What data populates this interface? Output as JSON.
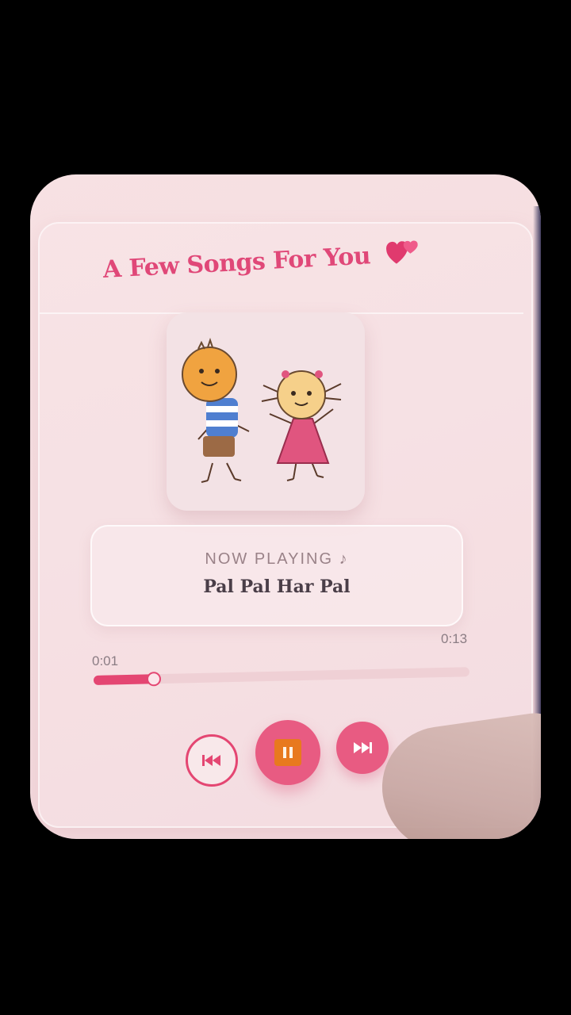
{
  "header": {
    "title": "A Few Songs For You",
    "title_emoji_icon": "two-hearts-icon"
  },
  "artwork": {
    "icon": "kids-dancing-illustration"
  },
  "now_playing": {
    "label": "NOW PLAYING ♪",
    "song_title": "Pal Pal Har Pal"
  },
  "progress": {
    "current_time": "0:01",
    "total_time": "0:13",
    "fraction": 0.16
  },
  "controls": {
    "prev_icon": "skip-previous-icon",
    "play_pause_icon": "pause-icon",
    "next_icon": "skip-next-icon"
  },
  "colors": {
    "accent": "#e44672",
    "title": "#e04878",
    "pause_square": "#e8791e",
    "background": "#f5dde0"
  }
}
